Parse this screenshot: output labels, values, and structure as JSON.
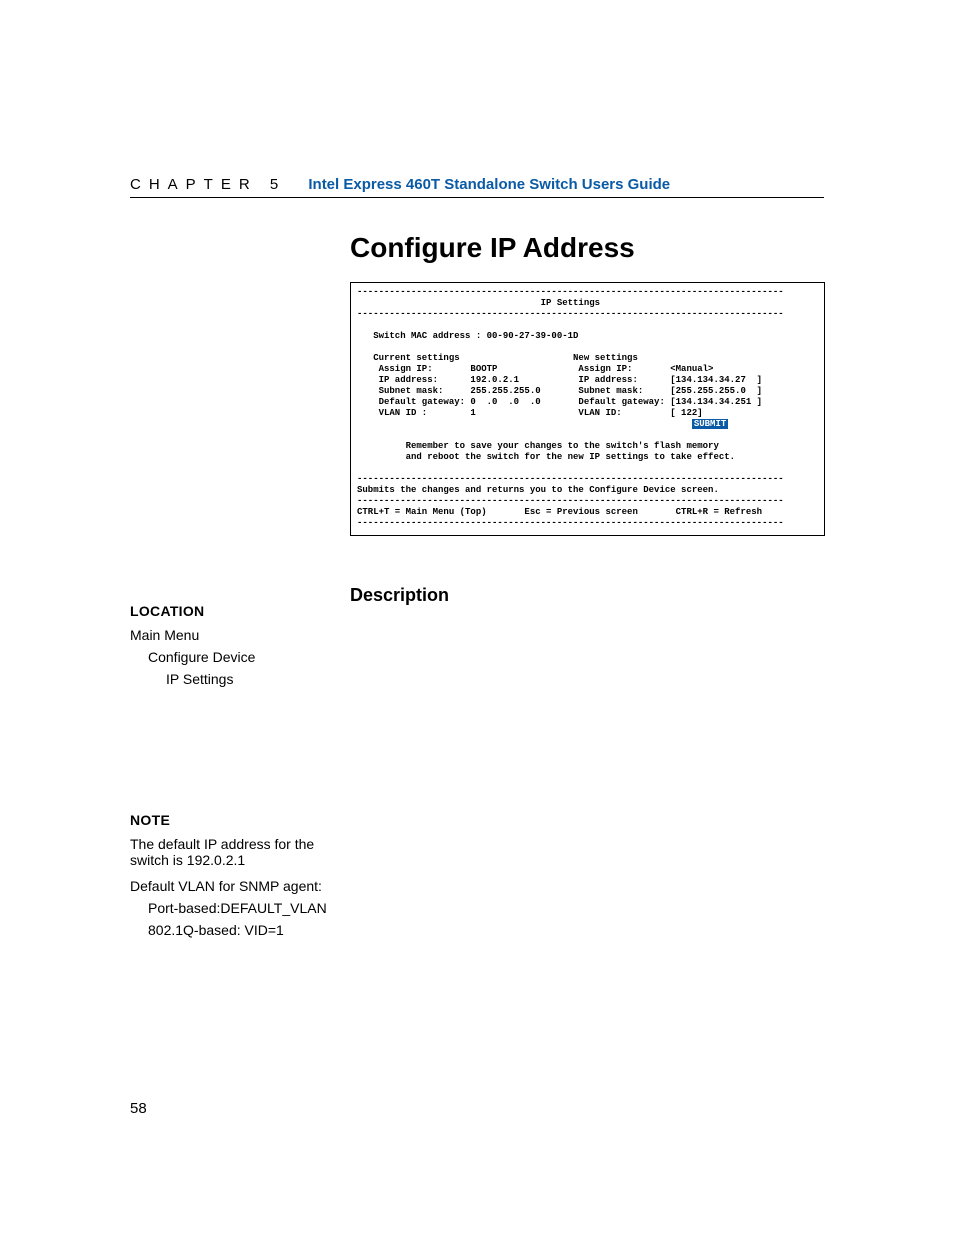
{
  "header": {
    "chapter": "CHAPTER 5",
    "title": "Intel Express 460T Standalone Switch Users Guide"
  },
  "main_title": "Configure IP Address",
  "terminal": {
    "rule": "-------------------------------------------------------------------------------",
    "title_line": "                                  IP Settings",
    "rule2": "-------------------------------------------------------------------------------",
    "mac_line": "   Switch MAC address : 00-90-27-39-00-1D",
    "hdr_line": "   Current settings                     New settings",
    "assign_line": "    Assign IP:       BOOTP               Assign IP:       <Manual>",
    "ip_line": "    IP address:      192.0.2.1           IP address:      [134.134.34.27  ]",
    "mask_line": "    Subnet mask:     255.255.255.0       Subnet mask:     [255.255.255.0  ]",
    "gw_line": "    Default gateway: 0  .0  .0  .0       Default gateway: [134.134.34.251 ]",
    "vlan_line": "    VLAN ID :        1                   VLAN ID:         [ 122]",
    "submit_label": "SUBMIT",
    "reminder1": "         Remember to save your changes to the switch's flash memory",
    "reminder2": "         and reboot the switch for the new IP settings to take effect.",
    "rule3": "-------------------------------------------------------------------------------",
    "submits_line": "Submits the changes and returns you to the Configure Device screen.",
    "rule4": "-------------------------------------------------------------------------------",
    "footer_line": "CTRL+T = Main Menu (Top)       Esc = Previous screen       CTRL+R = Refresh",
    "rule5": "-------------------------------------------------------------------------------"
  },
  "description_heading": "Description",
  "location": {
    "heading": "LOCATION",
    "items": [
      "Main Menu",
      "Configure Device",
      "IP Settings"
    ]
  },
  "note": {
    "heading": "NOTE",
    "line1": "The default IP address for the switch is 192.0.2.1",
    "line2": "Default VLAN for SNMP agent:",
    "line3": "Port-based:DEFAULT_VLAN",
    "line4": "802.1Q-based: VID=1"
  },
  "page_number": "58"
}
